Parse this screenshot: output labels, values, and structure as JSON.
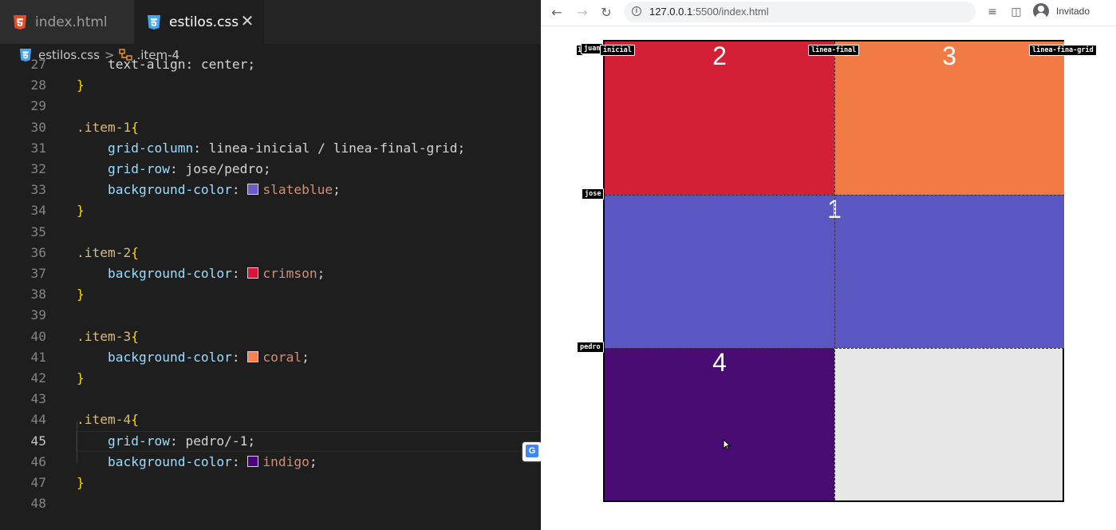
{
  "editor": {
    "tabs": [
      {
        "label": "index.html",
        "active": false,
        "icon": "html5-icon"
      },
      {
        "label": "estilos.css",
        "active": true,
        "icon": "css3-icon"
      }
    ],
    "close_glyph": "✕",
    "breadcrumb": {
      "file": "estilos.css",
      "separator": ">",
      "symbol": ".item-4"
    },
    "lines": [
      {
        "n": "27",
        "tokens": [
          {
            "t": "    text-align: center;",
            "c": "plain"
          }
        ]
      },
      {
        "n": "28",
        "tokens": [
          {
            "t": "}",
            "c": "brace"
          }
        ]
      },
      {
        "n": "29",
        "tokens": []
      },
      {
        "n": "30",
        "tokens": [
          {
            "t": ".item-1",
            "c": "sel"
          },
          {
            "t": "{",
            "c": "brace"
          }
        ]
      },
      {
        "n": "31",
        "tokens": [
          {
            "t": "    grid-column",
            "c": "prop"
          },
          {
            "t": ": linea-inicial / linea-final-grid;",
            "c": "plain"
          }
        ]
      },
      {
        "n": "32",
        "tokens": [
          {
            "t": "    grid-row",
            "c": "prop"
          },
          {
            "t": ": jose/pedro;",
            "c": "plain"
          }
        ]
      },
      {
        "n": "33",
        "tokens": [
          {
            "t": "    background-color",
            "c": "prop"
          },
          {
            "t": ": ",
            "c": "plain"
          },
          {
            "t": "slateblue",
            "c": "val",
            "swatch": "#6a5acd"
          },
          {
            "t": ";",
            "c": "plain"
          }
        ]
      },
      {
        "n": "34",
        "tokens": [
          {
            "t": "}",
            "c": "brace"
          }
        ]
      },
      {
        "n": "35",
        "tokens": []
      },
      {
        "n": "36",
        "tokens": [
          {
            "t": ".item-2",
            "c": "sel"
          },
          {
            "t": "{",
            "c": "brace"
          }
        ]
      },
      {
        "n": "37",
        "tokens": [
          {
            "t": "    background-color",
            "c": "prop"
          },
          {
            "t": ": ",
            "c": "plain"
          },
          {
            "t": "crimson",
            "c": "val",
            "swatch": "#dc143c"
          },
          {
            "t": ";",
            "c": "plain"
          }
        ]
      },
      {
        "n": "38",
        "tokens": [
          {
            "t": "}",
            "c": "brace"
          }
        ]
      },
      {
        "n": "39",
        "tokens": []
      },
      {
        "n": "40",
        "tokens": [
          {
            "t": ".item-3",
            "c": "sel"
          },
          {
            "t": "{",
            "c": "brace"
          }
        ]
      },
      {
        "n": "41",
        "tokens": [
          {
            "t": "    background-color",
            "c": "prop"
          },
          {
            "t": ": ",
            "c": "plain"
          },
          {
            "t": "coral",
            "c": "val",
            "swatch": "#ff7f50"
          },
          {
            "t": ";",
            "c": "plain"
          }
        ]
      },
      {
        "n": "42",
        "tokens": [
          {
            "t": "}",
            "c": "brace"
          }
        ]
      },
      {
        "n": "43",
        "tokens": []
      },
      {
        "n": "44",
        "tokens": [
          {
            "t": ".item-4",
            "c": "sel"
          },
          {
            "t": "{",
            "c": "brace"
          }
        ]
      },
      {
        "n": "45",
        "active": true,
        "tokens": [
          {
            "t": "    grid-row",
            "c": "prop"
          },
          {
            "t": ": pedro/-1;",
            "c": "plain"
          }
        ]
      },
      {
        "n": "46",
        "tokens": [
          {
            "t": "    background-color",
            "c": "prop"
          },
          {
            "t": ": ",
            "c": "plain"
          },
          {
            "t": "indigo",
            "c": "val",
            "swatch": "#4b0082"
          },
          {
            "t": ";",
            "c": "plain"
          }
        ]
      },
      {
        "n": "47",
        "tokens": [
          {
            "t": "}",
            "c": "brace"
          }
        ]
      },
      {
        "n": "48",
        "tokens": []
      }
    ],
    "translate_glyph": "G"
  },
  "browser": {
    "url_host": "127.0.0.1",
    "url_path": ":5500/index.html",
    "profile_label": "Invitado",
    "colors": {
      "item1": "#5b57c2",
      "item2": "#d42037",
      "item3": "#f27a45",
      "item4": "#480c73",
      "empty": "#e6e6e6"
    },
    "items": [
      {
        "name": "item-2",
        "label": "2"
      },
      {
        "name": "item-3",
        "label": "3"
      },
      {
        "name": "item-1",
        "label": "1"
      },
      {
        "name": "item-4",
        "label": "4"
      }
    ],
    "line_tags": {
      "row1_number": "1",
      "juan": "juan",
      "inicial": "inicial",
      "linea_final": "linea-final",
      "linea_fina_grid": "linea-fina-grid",
      "jose": "jose",
      "pedro": "pedro"
    }
  }
}
